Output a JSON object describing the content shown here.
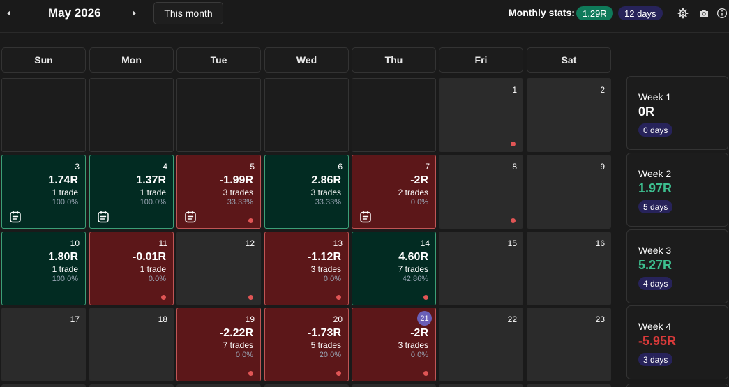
{
  "header": {
    "month_title": "May 2026",
    "this_month_label": "This month",
    "stats_label": "Monthly stats:",
    "stats_r": "1.29R",
    "stats_days": "12 days"
  },
  "weekdays": [
    "Sun",
    "Mon",
    "Tue",
    "Wed",
    "Thu",
    "Fri",
    "Sat"
  ],
  "colors": {
    "win": "#3dbf8f",
    "loss": "#d93a3a",
    "neutral": "#ffffff",
    "badge_days": "#27235a",
    "badge_r": "#0f7a5a"
  },
  "weeks": [
    {
      "label": "Week 1",
      "value": "0R",
      "days": "0 days",
      "tone": "neutral",
      "cells": [
        {
          "type": "empty"
        },
        {
          "type": "empty"
        },
        {
          "type": "empty"
        },
        {
          "type": "empty"
        },
        {
          "type": "empty"
        },
        {
          "type": "neutral",
          "day": "1",
          "dot": true
        },
        {
          "type": "neutral",
          "day": "2"
        }
      ]
    },
    {
      "label": "Week 2",
      "value": "1.97R",
      "days": "5 days",
      "tone": "win",
      "cells": [
        {
          "type": "win",
          "day": "3",
          "pnl": "1.74R",
          "trades": "1 trade",
          "winrate": "100.0%",
          "note": true
        },
        {
          "type": "win",
          "day": "4",
          "pnl": "1.37R",
          "trades": "1 trade",
          "winrate": "100.0%",
          "note": true
        },
        {
          "type": "loss",
          "day": "5",
          "pnl": "-1.99R",
          "trades": "3 trades",
          "winrate": "33.33%",
          "note": true,
          "dot": true
        },
        {
          "type": "win",
          "day": "6",
          "pnl": "2.86R",
          "trades": "3 trades",
          "winrate": "33.33%"
        },
        {
          "type": "loss",
          "day": "7",
          "pnl": "-2R",
          "trades": "2 trades",
          "winrate": "0.0%",
          "note": true
        },
        {
          "type": "neutral",
          "day": "8",
          "dot": true
        },
        {
          "type": "neutral",
          "day": "9"
        }
      ]
    },
    {
      "label": "Week 3",
      "value": "5.27R",
      "days": "4 days",
      "tone": "win",
      "cells": [
        {
          "type": "win",
          "day": "10",
          "pnl": "1.80R",
          "trades": "1 trade",
          "winrate": "100.0%"
        },
        {
          "type": "loss",
          "day": "11",
          "pnl": "-0.01R",
          "trades": "1 trade",
          "winrate": "0.0%",
          "dot": true
        },
        {
          "type": "neutral",
          "day": "12",
          "dot": true
        },
        {
          "type": "loss",
          "day": "13",
          "pnl": "-1.12R",
          "trades": "3 trades",
          "winrate": "0.0%",
          "dot": true
        },
        {
          "type": "win",
          "day": "14",
          "pnl": "4.60R",
          "trades": "7 trades",
          "winrate": "42.86%",
          "dot": true
        },
        {
          "type": "neutral",
          "day": "15"
        },
        {
          "type": "neutral",
          "day": "16"
        }
      ]
    },
    {
      "label": "Week 4",
      "value": "-5.95R",
      "days": "3 days",
      "tone": "loss",
      "cells": [
        {
          "type": "neutral",
          "day": "17"
        },
        {
          "type": "neutral",
          "day": "18"
        },
        {
          "type": "loss",
          "day": "19",
          "pnl": "-2.22R",
          "trades": "7 trades",
          "winrate": "0.0%",
          "dot": true
        },
        {
          "type": "loss",
          "day": "20",
          "pnl": "-1.73R",
          "trades": "5 trades",
          "winrate": "20.0%",
          "dot": true
        },
        {
          "type": "loss",
          "day": "21",
          "pnl": "-2R",
          "trades": "3 trades",
          "winrate": "0.0%",
          "dot": true,
          "today": true
        },
        {
          "type": "neutral",
          "day": "22"
        },
        {
          "type": "neutral",
          "day": "23"
        }
      ]
    }
  ]
}
